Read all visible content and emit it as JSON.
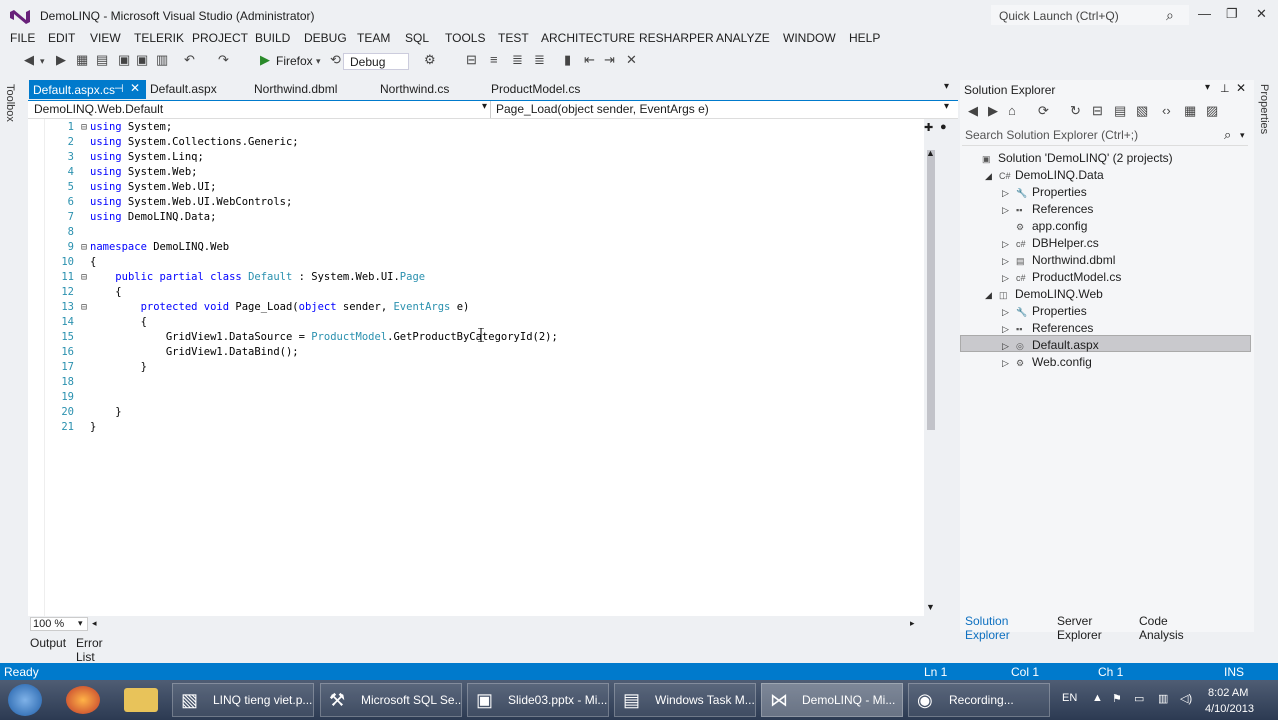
{
  "window": {
    "title": "DemoLINQ - Microsoft Visual Studio (Administrator)",
    "quick_launch_placeholder": "Quick Launch (Ctrl+Q)",
    "btn_minimize": "—",
    "btn_restore": "❐",
    "btn_close": "✕"
  },
  "menu": [
    "FILE",
    "EDIT",
    "VIEW",
    "TELERIK",
    "PROJECT",
    "BUILD",
    "DEBUG",
    "TEAM",
    "SQL",
    "TOOLS",
    "TEST",
    "ARCHITECTURE",
    "RESHARPER",
    "ANALYZE",
    "WINDOW",
    "HELP"
  ],
  "toolbar": {
    "browser": "Firefox",
    "config": "Debug"
  },
  "left_rail": {
    "toolbox": "Toolbox"
  },
  "tabs": [
    {
      "label": "Default.aspx.cs",
      "active": true
    },
    {
      "label": "Default.aspx"
    },
    {
      "label": "Northwind.dbml"
    },
    {
      "label": "Northwind.cs"
    },
    {
      "label": "ProductModel.cs"
    }
  ],
  "navbar": {
    "class_selector": "DemoLINQ.Web.Default",
    "member_selector": "Page_Load(object sender, EventArgs e)"
  },
  "code": [
    {
      "n": "1",
      "fold": "⊟",
      "tokens": [
        [
          "kw",
          "using"
        ],
        [
          "",
          " System;"
        ]
      ]
    },
    {
      "n": "2",
      "fold": "",
      "tokens": [
        [
          "kw",
          "using"
        ],
        [
          "",
          " System.Collections.Generic;"
        ]
      ]
    },
    {
      "n": "3",
      "fold": "",
      "tokens": [
        [
          "kw",
          "using"
        ],
        [
          "",
          " System.Linq;"
        ]
      ]
    },
    {
      "n": "4",
      "fold": "",
      "tokens": [
        [
          "kw",
          "using"
        ],
        [
          "",
          " System.Web;"
        ]
      ]
    },
    {
      "n": "5",
      "fold": "",
      "tokens": [
        [
          "kw",
          "using"
        ],
        [
          "",
          " System.Web.UI;"
        ]
      ]
    },
    {
      "n": "6",
      "fold": "",
      "tokens": [
        [
          "kw",
          "using"
        ],
        [
          "",
          " System.Web.UI.WebControls;"
        ]
      ]
    },
    {
      "n": "7",
      "fold": "",
      "tokens": [
        [
          "kw",
          "using"
        ],
        [
          "",
          " DemoLINQ.Data;"
        ]
      ]
    },
    {
      "n": "8",
      "fold": "",
      "tokens": [
        [
          "",
          ""
        ]
      ]
    },
    {
      "n": "9",
      "fold": "⊟",
      "tokens": [
        [
          "kw",
          "namespace"
        ],
        [
          "",
          " DemoLINQ.Web"
        ]
      ]
    },
    {
      "n": "10",
      "fold": "",
      "tokens": [
        [
          "",
          "{"
        ]
      ]
    },
    {
      "n": "11",
      "fold": "⊟",
      "tokens": [
        [
          "",
          "    "
        ],
        [
          "kw",
          "public partial class"
        ],
        [
          "",
          " "
        ],
        [
          "ty",
          "Default"
        ],
        [
          "",
          " : System.Web.UI."
        ],
        [
          "ty",
          "Page"
        ]
      ]
    },
    {
      "n": "12",
      "fold": "",
      "tokens": [
        [
          "",
          "    {"
        ]
      ]
    },
    {
      "n": "13",
      "fold": "⊟",
      "tokens": [
        [
          "",
          "        "
        ],
        [
          "kw",
          "protected void"
        ],
        [
          "",
          " Page_Load("
        ],
        [
          "kw",
          "object"
        ],
        [
          "",
          " sender, "
        ],
        [
          "ty",
          "EventArgs"
        ],
        [
          "",
          " e)"
        ]
      ]
    },
    {
      "n": "14",
      "fold": "",
      "tokens": [
        [
          "",
          "        {"
        ]
      ]
    },
    {
      "n": "15",
      "fold": "",
      "tokens": [
        [
          "",
          "            GridView1.DataSource = "
        ],
        [
          "ty",
          "ProductModel"
        ],
        [
          "",
          ".GetProductByCategoryId(2);"
        ]
      ]
    },
    {
      "n": "16",
      "fold": "",
      "tokens": [
        [
          "",
          "            GridView1.DataBind();"
        ]
      ]
    },
    {
      "n": "17",
      "fold": "",
      "tokens": [
        [
          "",
          "        }"
        ]
      ]
    },
    {
      "n": "18",
      "fold": "",
      "tokens": [
        [
          "",
          ""
        ]
      ]
    },
    {
      "n": "19",
      "fold": "",
      "tokens": [
        [
          "",
          ""
        ]
      ]
    },
    {
      "n": "20",
      "fold": "",
      "tokens": [
        [
          "",
          "    }"
        ]
      ]
    },
    {
      "n": "21",
      "fold": "",
      "tokens": [
        [
          "",
          "}"
        ]
      ]
    }
  ],
  "editor": {
    "zoom": "100 %"
  },
  "bottom_tabs": [
    "Output",
    "Error List"
  ],
  "solution_explorer": {
    "title": "Solution Explorer",
    "search_placeholder": "Search Solution Explorer (Ctrl+;)",
    "tree": [
      {
        "label": "Solution 'DemoLINQ' (2 projects)",
        "depth": 0,
        "arrow": "",
        "icon": "solution-icon"
      },
      {
        "label": "DemoLINQ.Data",
        "depth": 1,
        "arrow": "◢",
        "icon": "csproject-icon"
      },
      {
        "label": "Properties",
        "depth": 2,
        "arrow": "▷",
        "icon": "wrench-icon"
      },
      {
        "label": "References",
        "depth": 2,
        "arrow": "▷",
        "icon": "references-icon"
      },
      {
        "label": "app.config",
        "depth": 2,
        "arrow": "",
        "icon": "config-file-icon"
      },
      {
        "label": "DBHelper.cs",
        "depth": 2,
        "arrow": "▷",
        "icon": "csharp-file-icon"
      },
      {
        "label": "Northwind.dbml",
        "depth": 2,
        "arrow": "▷",
        "icon": "dbml-file-icon"
      },
      {
        "label": "ProductModel.cs",
        "depth": 2,
        "arrow": "▷",
        "icon": "csharp-file-icon"
      },
      {
        "label": "DemoLINQ.Web",
        "depth": 1,
        "arrow": "◢",
        "icon": "web-project-icon"
      },
      {
        "label": "Properties",
        "depth": 2,
        "arrow": "▷",
        "icon": "wrench-icon"
      },
      {
        "label": "References",
        "depth": 2,
        "arrow": "▷",
        "icon": "references-icon"
      },
      {
        "label": "Default.aspx",
        "depth": 2,
        "arrow": "▷",
        "icon": "aspx-file-icon",
        "selected": true
      },
      {
        "label": "Web.config",
        "depth": 2,
        "arrow": "▷",
        "icon": "config-file-icon"
      }
    ],
    "bottom_tabs": [
      "Solution Explorer",
      "Server Explorer",
      "Code Analysis"
    ]
  },
  "right_rail": {
    "properties": "Properties"
  },
  "status": {
    "ready": "Ready",
    "ln": "Ln 1",
    "col": "Col 1",
    "ch": "Ch 1",
    "ins": "INS"
  },
  "taskbar": {
    "items": [
      {
        "label": "LINQ tieng viet.p...",
        "icon": "word-icon"
      },
      {
        "label": "Microsoft SQL Se...",
        "icon": "sql-server-icon"
      },
      {
        "label": "Slide03.pptx - Mi...",
        "icon": "powerpoint-icon"
      },
      {
        "label": "Windows Task M...",
        "icon": "task-manager-icon"
      },
      {
        "label": "DemoLINQ - Mi...",
        "icon": "visual-studio-icon"
      },
      {
        "label": "Recording...",
        "icon": "recorder-icon"
      }
    ],
    "lang": "EN",
    "time": "8:02 AM",
    "date": "4/10/2013"
  }
}
